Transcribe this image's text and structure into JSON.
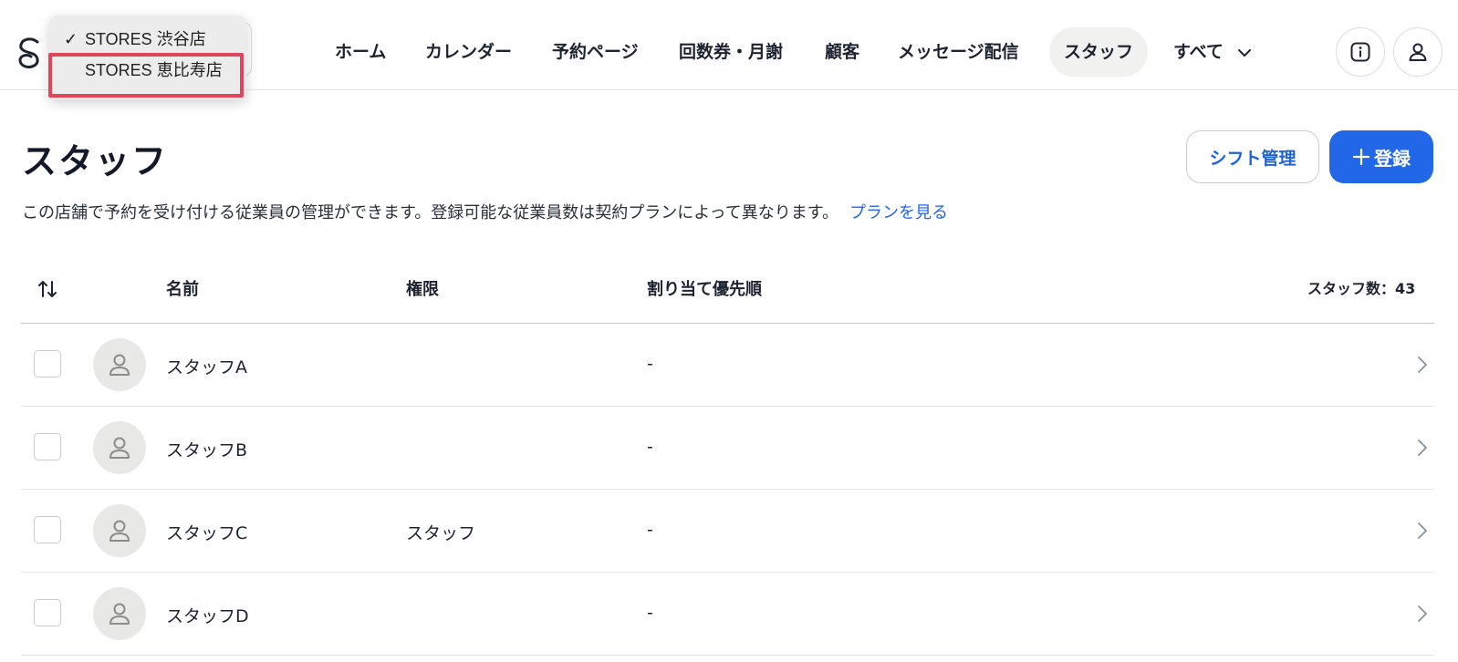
{
  "store_switcher": {
    "options": [
      {
        "label": "STORES 渋谷店",
        "selected": true,
        "check": "✓"
      },
      {
        "label": "STORES 恵比寿店",
        "selected": false,
        "check": ""
      }
    ]
  },
  "nav": {
    "items": [
      {
        "label": "ホーム"
      },
      {
        "label": "カレンダー"
      },
      {
        "label": "予約ページ"
      },
      {
        "label": "回数券・月謝"
      },
      {
        "label": "顧客"
      },
      {
        "label": "メッセージ配信"
      },
      {
        "label": "スタッフ",
        "active": true
      },
      {
        "label": "すべて"
      }
    ]
  },
  "header_icons": [
    "info-icon",
    "user-icon"
  ],
  "page": {
    "title": "スタッフ",
    "shift_button": "シフト管理",
    "register_button": "登録",
    "description": "この店舗で予約を受け付ける従業員の管理ができます。登録可能な従業員数は契約プランによって異なります。",
    "plan_link": "プランを見る"
  },
  "table": {
    "headers": {
      "name": "名前",
      "role": "権限",
      "priority": "割り当て優先順",
      "count": "スタッフ数：43"
    },
    "rows": [
      {
        "name": "スタッフA",
        "role": "",
        "priority": "-"
      },
      {
        "name": "スタッフB",
        "role": "",
        "priority": "-"
      },
      {
        "name": "スタッフC",
        "role": "スタッフ",
        "priority": "-"
      },
      {
        "name": "スタッフD",
        "role": "",
        "priority": "-"
      }
    ]
  },
  "colors": {
    "accent": "#2167e8",
    "highlight": "#e0455b",
    "active_nav_bg": "#f1f1ef"
  }
}
